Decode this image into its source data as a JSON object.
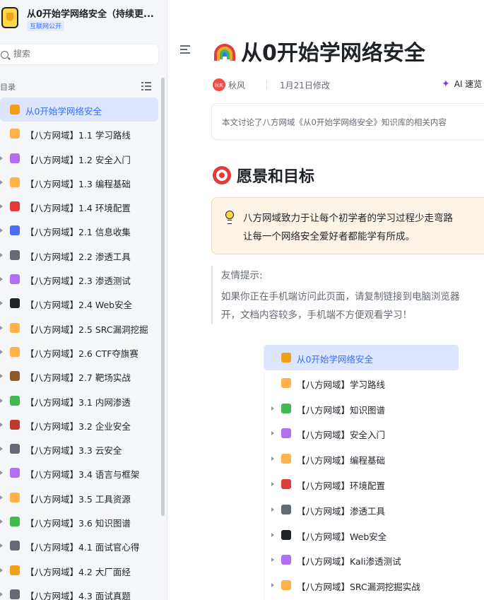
{
  "knowledge_base": {
    "title": "从0开始学网络安全（持续更...",
    "badge": "互联网公开"
  },
  "search": {
    "placeholder": "搜索"
  },
  "toc": {
    "label": "目录"
  },
  "tree_items": [
    {
      "label": "从0开始学网络安全",
      "icon": "rainbow-icon",
      "color": "#f29f1a",
      "caret": false,
      "active": true
    },
    {
      "label": "【八方网域】1.1 学习路线",
      "icon": "roadmap-icon",
      "color": "#ffb14a",
      "caret": false
    },
    {
      "label": "【八方网域】1.2 安全入门",
      "icon": "shield-icon",
      "color": "#b26ef7",
      "caret": true
    },
    {
      "label": "【八方网域】1.3 编程基础",
      "icon": "code-icon",
      "color": "#ffb14a",
      "caret": true
    },
    {
      "label": "【八方网域】1.4 环境配置",
      "icon": "target-icon",
      "color": "#e23b3b",
      "caret": true
    },
    {
      "label": "【八方网域】2.1 信息收集",
      "icon": "magnifier-icon",
      "color": "#4a6cf7",
      "caret": true
    },
    {
      "label": "【八方网域】2.2 渗透工具",
      "icon": "gear-icon",
      "color": "#646a73",
      "caret": true
    },
    {
      "label": "【八方网域】2.3 渗透测试",
      "icon": "test-icon",
      "color": "#b26ef7",
      "caret": true
    },
    {
      "label": "【八方网域】2.4 Web安全",
      "icon": "monitor-icon",
      "color": "#1f2329",
      "caret": true
    },
    {
      "label": "【八方网域】2.5 SRC漏洞挖掘",
      "icon": "bug-icon",
      "color": "#ffb14a",
      "caret": true
    },
    {
      "label": "【八方网域】2.6 CTF夺旗赛",
      "icon": "flag-icon",
      "color": "#ffb14a",
      "caret": true
    },
    {
      "label": "【八方网域】2.7 靶场实战",
      "icon": "clock-icon",
      "color": "#8a5a2b",
      "caret": true
    },
    {
      "label": "【八方网域】3.1 内网渗透",
      "icon": "network-icon",
      "color": "#3fb950",
      "caret": true
    },
    {
      "label": "【八方网域】3.2 企业安全",
      "icon": "building-icon",
      "color": "#c0392b",
      "caret": true
    },
    {
      "label": "【八方网域】3.3 云安全",
      "icon": "cloud-icon",
      "color": "#646a73",
      "caret": true
    },
    {
      "label": "【八方网域】3.4 语言与框架",
      "icon": "framework-icon",
      "color": "#b26ef7",
      "caret": true
    },
    {
      "label": "【八方网域】3.5 工具资源",
      "icon": "toolbox-icon",
      "color": "#ffb14a",
      "caret": true
    },
    {
      "label": "【八方网域】3.6 知识图谱",
      "icon": "chart-icon",
      "color": "#3fb950",
      "caret": true
    },
    {
      "label": "【八方网域】4.1 面试官心得",
      "icon": "chat-icon",
      "color": "#646a73",
      "caret": true
    },
    {
      "label": "【八方网域】4.2 大厂面经",
      "icon": "pen-icon",
      "color": "#f29f1a",
      "caret": true
    },
    {
      "label": "【八方网域】4.3 面试真题",
      "icon": "doc-icon",
      "color": "#646a73",
      "caret": true
    }
  ],
  "doc": {
    "title": "从0开始学网络安全",
    "author": "秋风",
    "author_avatar": "秋风",
    "modified": "1月21日修改",
    "ai_button": "AI 速览",
    "summary": "本文讨论了八方网域《从0开始学网络安全》知识库的相关内容",
    "section_title": "愿景和目标",
    "callout_lines": [
      "八方网域致力于让每个初学者的学习过程少走弯路",
      "让每一个网络安全爱好者都能学有所成。"
    ],
    "quote_lines": [
      "友情提示:",
      "如果你正在手机端访问此页面，请复制链接到电脑浏览器",
      "开，文档内容较多，手机端不方便观看学习！"
    ]
  },
  "embed_items": [
    {
      "label": "从0开始学网络安全",
      "icon": "rainbow-icon",
      "color": "#f29f1a",
      "caret": false,
      "active": true
    },
    {
      "label": "【八方网域】学习路线",
      "icon": "roadmap-icon",
      "color": "#ffb14a",
      "caret": false
    },
    {
      "label": "【八方网域】知识图谱",
      "icon": "chart-icon",
      "color": "#3fb950",
      "caret": true
    },
    {
      "label": "【八方网域】安全入门",
      "icon": "shield-icon",
      "color": "#b26ef7",
      "caret": true
    },
    {
      "label": "【八方网域】编程基础",
      "icon": "code-icon",
      "color": "#ffb14a",
      "caret": true
    },
    {
      "label": "【八方网域】环境配置",
      "icon": "target-icon",
      "color": "#e23b3b",
      "caret": true
    },
    {
      "label": "【八方网域】渗透工具",
      "icon": "gear-icon",
      "color": "#646a73",
      "caret": true
    },
    {
      "label": "【八方网域】Web安全",
      "icon": "monitor-icon",
      "color": "#1f2329",
      "caret": true
    },
    {
      "label": "【八方网域】Kali渗透测试",
      "icon": "test-icon",
      "color": "#b26ef7",
      "caret": true
    },
    {
      "label": "【八方网域】SRC漏洞挖掘实战",
      "icon": "bug-icon",
      "color": "#ffb14a",
      "caret": true
    }
  ],
  "colors": {
    "accent": "#3370ff",
    "active_bg": "#dde5ff",
    "callout_bg": "#fef4e6",
    "ai_accent": "#7f3bf5"
  }
}
